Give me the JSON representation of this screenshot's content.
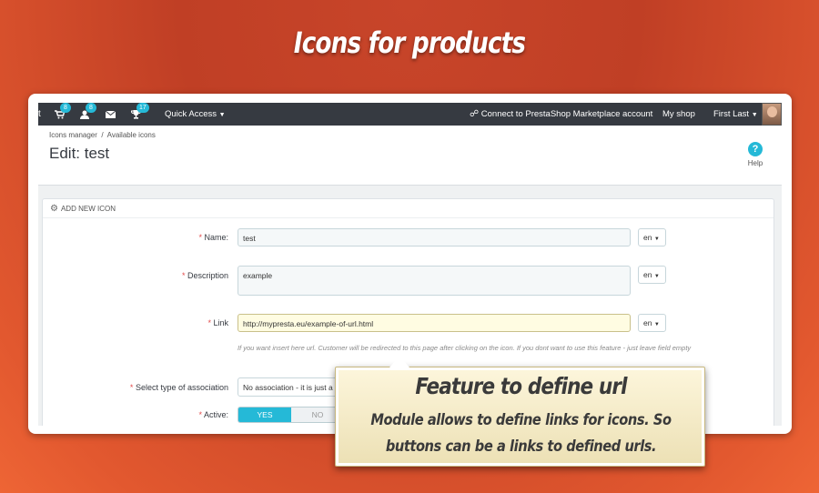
{
  "hero": {
    "title": "Icons for products"
  },
  "topbar": {
    "stub": "t",
    "cart_badge": "8",
    "customers_badge": "8",
    "messages_badge": "",
    "trophy_badge": "17",
    "quick_access": "Quick Access",
    "connect": "Connect to PrestaShop Marketplace account",
    "my_shop": "My shop",
    "user": "First Last"
  },
  "header": {
    "breadcrumb": [
      "Icons manager",
      "/",
      "Available icons"
    ],
    "title": "Edit: test",
    "help_label": "Help"
  },
  "panel": {
    "heading": "ADD NEW ICON",
    "fields": {
      "name": {
        "label": "Name:",
        "value": "test",
        "lang": "en"
      },
      "description": {
        "label": "Description",
        "value": "example",
        "lang": "en"
      },
      "link": {
        "label": "Link",
        "value": "http://mypresta.eu/example-of-url.html",
        "lang": "en"
      },
      "link_hint": "If you want insert here url. Customer will be redirected to this page after clicking on the icon. If you dont want to use this feature - just leave field empty",
      "association": {
        "label": "Select type of association",
        "value": "No association - it is just a"
      },
      "active": {
        "label": "Active:",
        "yes": "YES",
        "no": "NO"
      }
    }
  },
  "callout": {
    "title": "Feature to define url",
    "body": "Module allows to define links for icons. So buttons can be a links to defined urls."
  },
  "colors": {
    "accent": "#25b9d7",
    "topbar": "#363a41",
    "required": "#e34b4b"
  }
}
